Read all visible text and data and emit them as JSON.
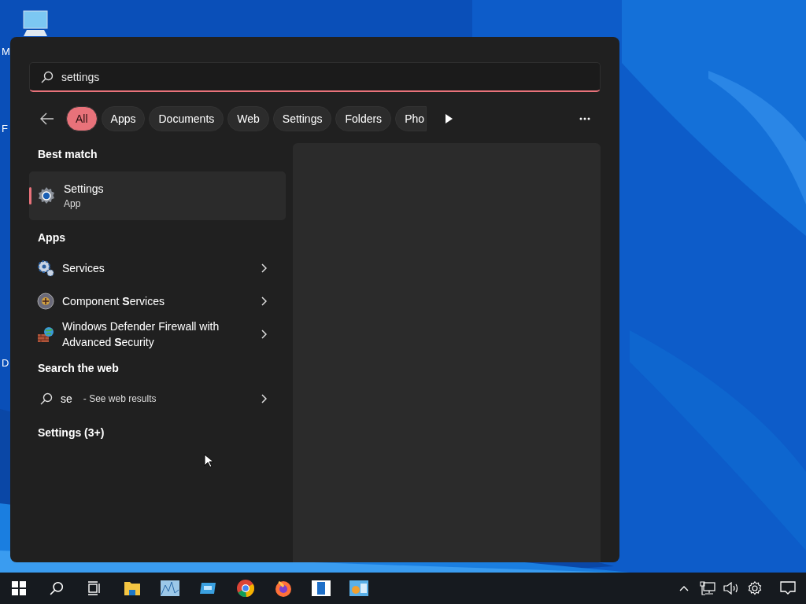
{
  "desktop": {
    "icon_labels": [
      "M",
      "F",
      "D"
    ]
  },
  "search": {
    "value": "settings"
  },
  "filters": [
    {
      "label": "All",
      "selected": true
    },
    {
      "label": "Apps",
      "selected": false
    },
    {
      "label": "Documents",
      "selected": false
    },
    {
      "label": "Web",
      "selected": false
    },
    {
      "label": "Settings",
      "selected": false
    },
    {
      "label": "Folders",
      "selected": false
    },
    {
      "label": "Pho",
      "selected": false
    }
  ],
  "best_match": {
    "heading": "Best match",
    "title": "Settings",
    "subtitle": "App",
    "selected": true
  },
  "apps": {
    "heading": "Apps",
    "items": [
      {
        "kind": "services",
        "label": "Services"
      },
      {
        "kind": "component",
        "label": "Component **S**ervices"
      },
      {
        "kind": "firewall",
        "label": "Windows Defender Firewall with Advanced **S**ecurity"
      }
    ]
  },
  "web": {
    "heading": "Search the web",
    "query": "se",
    "hint": "- See web results"
  },
  "settings_group": {
    "heading": "Settings (3+)"
  }
}
